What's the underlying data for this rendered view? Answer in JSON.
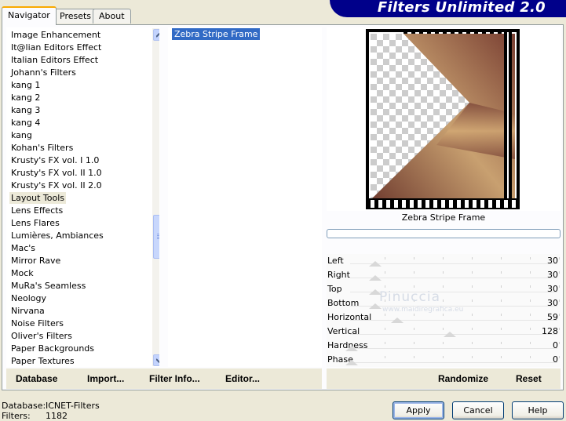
{
  "banner": {
    "title": "Filters Unlimited 2.0"
  },
  "tabs": [
    {
      "label": "Navigator",
      "active": true
    },
    {
      "label": "Presets",
      "active": false
    },
    {
      "label": "About",
      "active": false
    }
  ],
  "categories": [
    "Image Enhancement",
    "It@lian Editors Effect",
    "Italian Editors Effect",
    "Johann's Filters",
    "kang 1",
    "kang 2",
    "kang 3",
    "kang 4",
    "kang",
    "Kohan's Filters",
    "Krusty's FX vol. I 1.0",
    "Krusty's FX vol. II 1.0",
    "Krusty's FX vol. II 2.0",
    "Layout Tools",
    "Lens Effects",
    "Lens Flares",
    "Lumières, Ambiances",
    "Mac's",
    "Mirror Rave",
    "Mock",
    "MuRa's Seamless",
    "Neology",
    "Nirvana",
    "Noise Filters",
    "Oliver's Filters",
    "Paper Backgrounds",
    "Paper Textures"
  ],
  "selected_category": "Layout Tools",
  "filters": [
    "Zebra Stripe Frame"
  ],
  "preview": {
    "filter_name": "Zebra Stripe Frame"
  },
  "sliders": [
    {
      "label": "Left",
      "value": "30",
      "level": 0.12
    },
    {
      "label": "Right",
      "value": "30",
      "level": 0.12
    },
    {
      "label": "Top",
      "value": "30",
      "level": 0.12
    },
    {
      "label": "Bottom",
      "value": "30",
      "level": 0.12
    },
    {
      "label": "Horizontal",
      "value": "59",
      "level": 0.23
    },
    {
      "label": "Vertical",
      "value": "128",
      "level": 0.5
    },
    {
      "label": "Hardness",
      "value": "0",
      "level": 0
    },
    {
      "label": "Phase",
      "value": "0",
      "level": 0
    }
  ],
  "watermark": {
    "name": "Pinuccia",
    "site": "www.maidiregrafica.eu"
  },
  "left_actions": {
    "database": "Database",
    "import": "Import...",
    "filter_info": "Filter Info...",
    "editor": "Editor..."
  },
  "right_actions": {
    "randomize": "Randomize",
    "reset": "Reset"
  },
  "status": {
    "database_label": "Database:",
    "database_value": "ICNET-Filters",
    "filters_label": "Filters:",
    "filters_value": "1182"
  },
  "buttons": {
    "apply": "Apply",
    "cancel": "Cancel",
    "help": "Help"
  },
  "colors": {
    "banner": "#00008a",
    "selection": "#316ac5",
    "tab_accent": "#f9a900"
  }
}
